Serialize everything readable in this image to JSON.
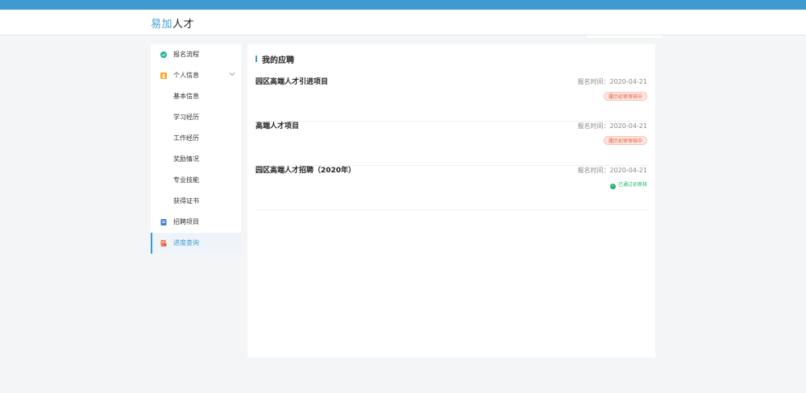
{
  "header": {
    "logo_part1": "易加",
    "logo_part2": "人才"
  },
  "sidebar": {
    "items": [
      {
        "label": "报名流程",
        "icon": "circle-flow-icon"
      },
      {
        "label": "个人信息",
        "icon": "person-card-icon"
      },
      {
        "label": "基本信息"
      },
      {
        "label": "学习经历"
      },
      {
        "label": "工作经历"
      },
      {
        "label": "奖励情况"
      },
      {
        "label": "专业技能"
      },
      {
        "label": "获得证书"
      },
      {
        "label": "招聘项目",
        "icon": "project-book-icon"
      },
      {
        "label": "进度查询",
        "icon": "progress-doc-icon"
      }
    ]
  },
  "main": {
    "title": "我的应聘",
    "applications": [
      {
        "name": "园区高端人才引进项目",
        "date": "报名时间：2020-04-21",
        "status": "履历初审审核中"
      },
      {
        "name": "高端人才项目",
        "date": "报名时间：2020-04-21",
        "status": "履历初审审核中"
      },
      {
        "name": "园区高端人才招聘（2020年）",
        "date": "报名时间：2020-04-21",
        "status": "已通过初审核"
      }
    ]
  },
  "colors": {
    "brand": "#3d9bd0",
    "pending": "#e4593b",
    "passed": "#1bb56a"
  }
}
